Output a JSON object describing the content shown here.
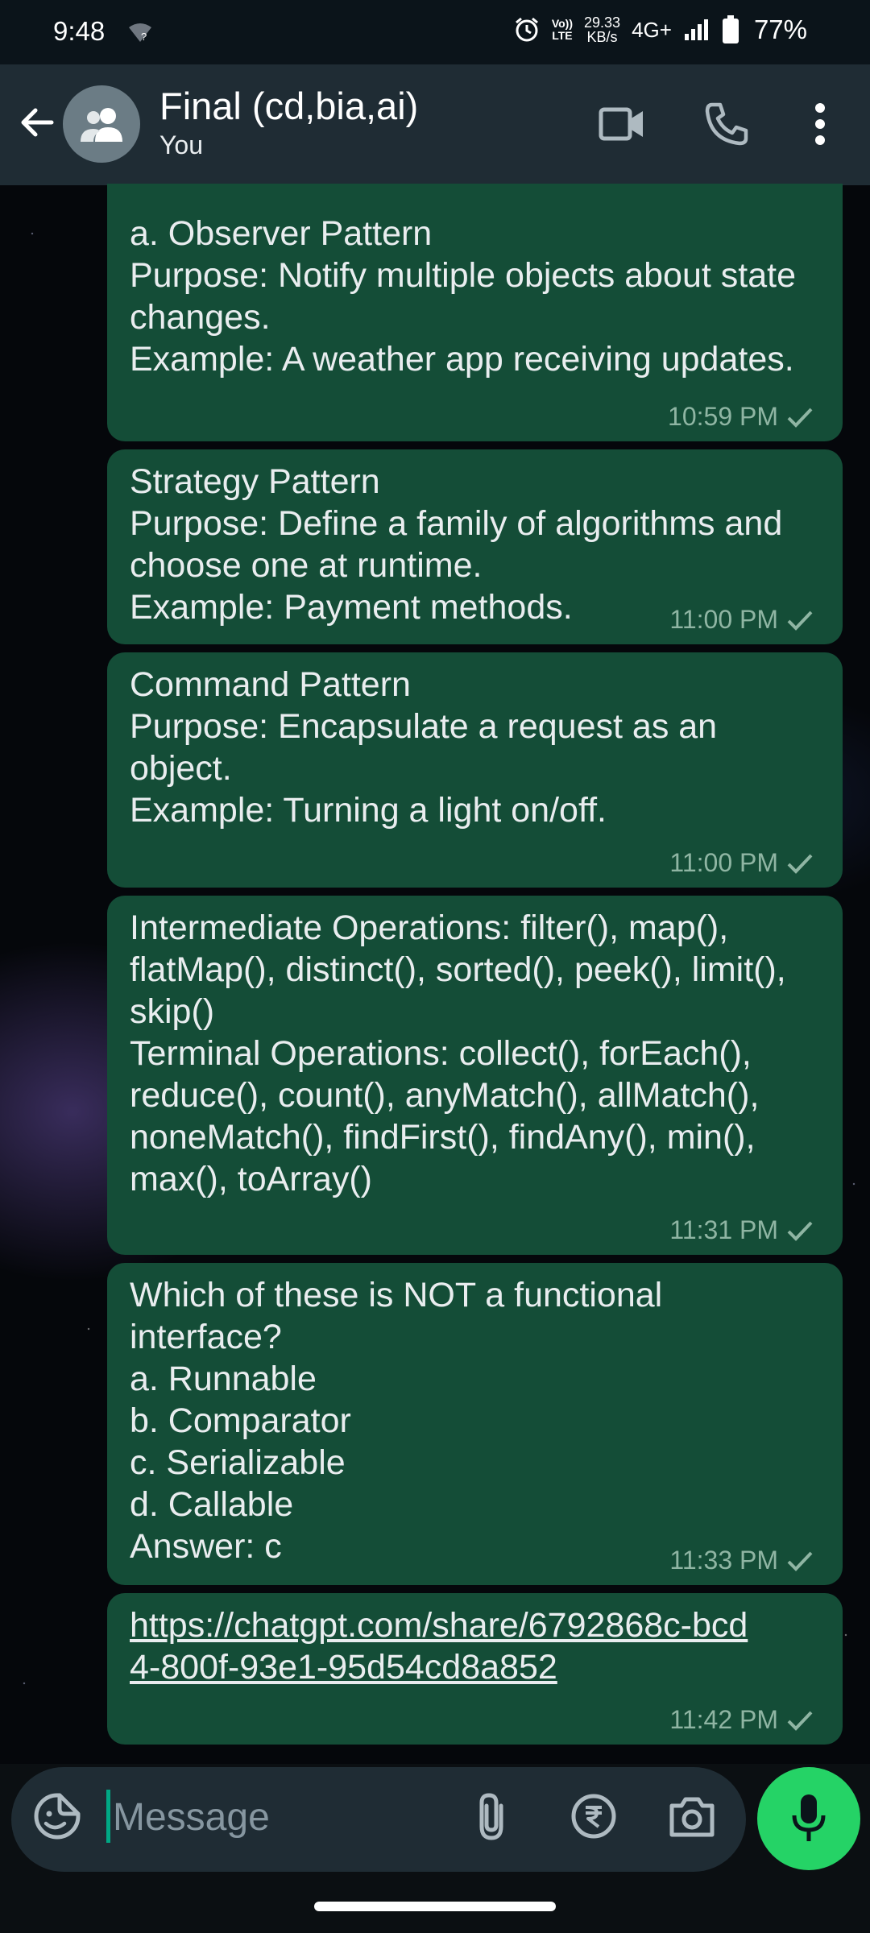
{
  "status_bar": {
    "time": "9:48",
    "volte": "Vo))\nLTE",
    "net_speed": "29.33\nKB/s",
    "network": "4G+",
    "battery": "77%"
  },
  "header": {
    "title": "Final (cd,bia,ai)",
    "subtitle": "You"
  },
  "messages": [
    {
      "text": "a. Observer Pattern\nPurpose: Notify multiple objects about state changes.\nExample: A weather app receiving updates.",
      "time": "10:59 PM"
    },
    {
      "text": "Strategy Pattern\nPurpose: Define a family of algorithms and choose one at runtime.\nExample: Payment methods.",
      "time": "11:00 PM"
    },
    {
      "text": "Command Pattern\nPurpose: Encapsulate a request as an object.\nExample: Turning a light on/off.",
      "time": "11:00 PM"
    },
    {
      "text": "Intermediate Operations: filter(), map(), flatMap(), distinct(), sorted(), peek(), limit(), skip()\nTerminal Operations: collect(), forEach(), reduce(), count(), anyMatch(), allMatch(), noneMatch(), findFirst(), findAny(), min(), max(), toArray()",
      "time": "11:31 PM"
    },
    {
      "text": "Which of these is NOT a functional interface?\na. Runnable\nb. Comparator\nc. Serializable\nd. Callable\nAnswer: c",
      "time": "11:33 PM"
    },
    {
      "text": "https://chatgpt.com/share/6792868c-bcd4-800f-93e1-95d54cd8a852",
      "time": "11:42 PM"
    }
  ],
  "composer": {
    "placeholder": "Message"
  },
  "icons": {
    "back": "arrow-left-icon",
    "avatar": "group-icon",
    "video": "video-call-icon",
    "call": "phone-icon",
    "menu": "more-vert-icon",
    "emoji": "sticker-icon",
    "attach": "paperclip-icon",
    "payment": "rupee-icon",
    "camera": "camera-icon",
    "mic": "mic-icon"
  },
  "colors": {
    "bubble": "#144d37",
    "header": "#1f2c34",
    "accent": "#25d366",
    "link": "#53bdeb"
  }
}
